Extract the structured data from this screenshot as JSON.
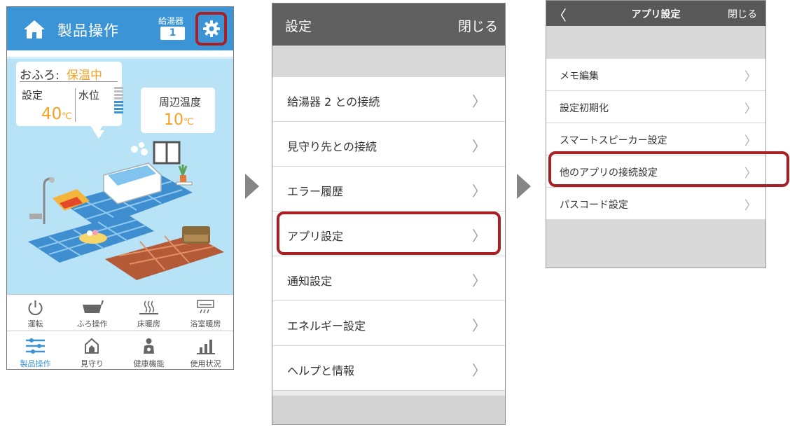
{
  "panel1": {
    "title": "製品操作",
    "heater_label": "給湯器",
    "heater_number": "1",
    "bath": {
      "label": "おふろ:",
      "status": "保温中",
      "set_label": "設定",
      "set_temp": "40",
      "temp_unit": "℃",
      "water_label": "水位"
    },
    "ambient": {
      "label": "周辺温度",
      "temp": "10",
      "unit": "℃"
    },
    "nav_row1": [
      {
        "label": "運転",
        "icon": "power-icon"
      },
      {
        "label": "ふろ操作",
        "icon": "bathtub-icon"
      },
      {
        "label": "床暖房",
        "icon": "floor-heating-icon"
      },
      {
        "label": "浴室暖房",
        "icon": "bathroom-heater-icon"
      }
    ],
    "nav_row2": [
      {
        "label": "製品操作",
        "icon": "sliders-icon",
        "active": true
      },
      {
        "label": "見守り",
        "icon": "monitor-home-icon"
      },
      {
        "label": "健康機能",
        "icon": "health-person-icon"
      },
      {
        "label": "使用状況",
        "icon": "bar-chart-icon"
      }
    ],
    "colors": {
      "header": "#3a94d6",
      "accent": "#f5a023",
      "highlight": "#a81f24"
    }
  },
  "panel2": {
    "title": "設定",
    "close": "閉じる",
    "items": [
      {
        "label": "給湯器 2 との接続"
      },
      {
        "label": "見守り先との接続"
      },
      {
        "label": "エラー履歴"
      },
      {
        "label": "アプリ設定"
      },
      {
        "label": "通知設定"
      },
      {
        "label": "エネルギー設定"
      },
      {
        "label": "ヘルプと情報"
      }
    ],
    "chevron": "〉"
  },
  "panel3": {
    "back": "〈",
    "title": "アプリ設定",
    "close": "閉じる",
    "items": [
      {
        "label": "メモ編集"
      },
      {
        "label": "設定初期化"
      },
      {
        "label": "スマートスピーカー設定"
      },
      {
        "label": "他のアプリの接続設定"
      },
      {
        "label": "パスコード設定"
      }
    ],
    "chevron": "〉"
  }
}
